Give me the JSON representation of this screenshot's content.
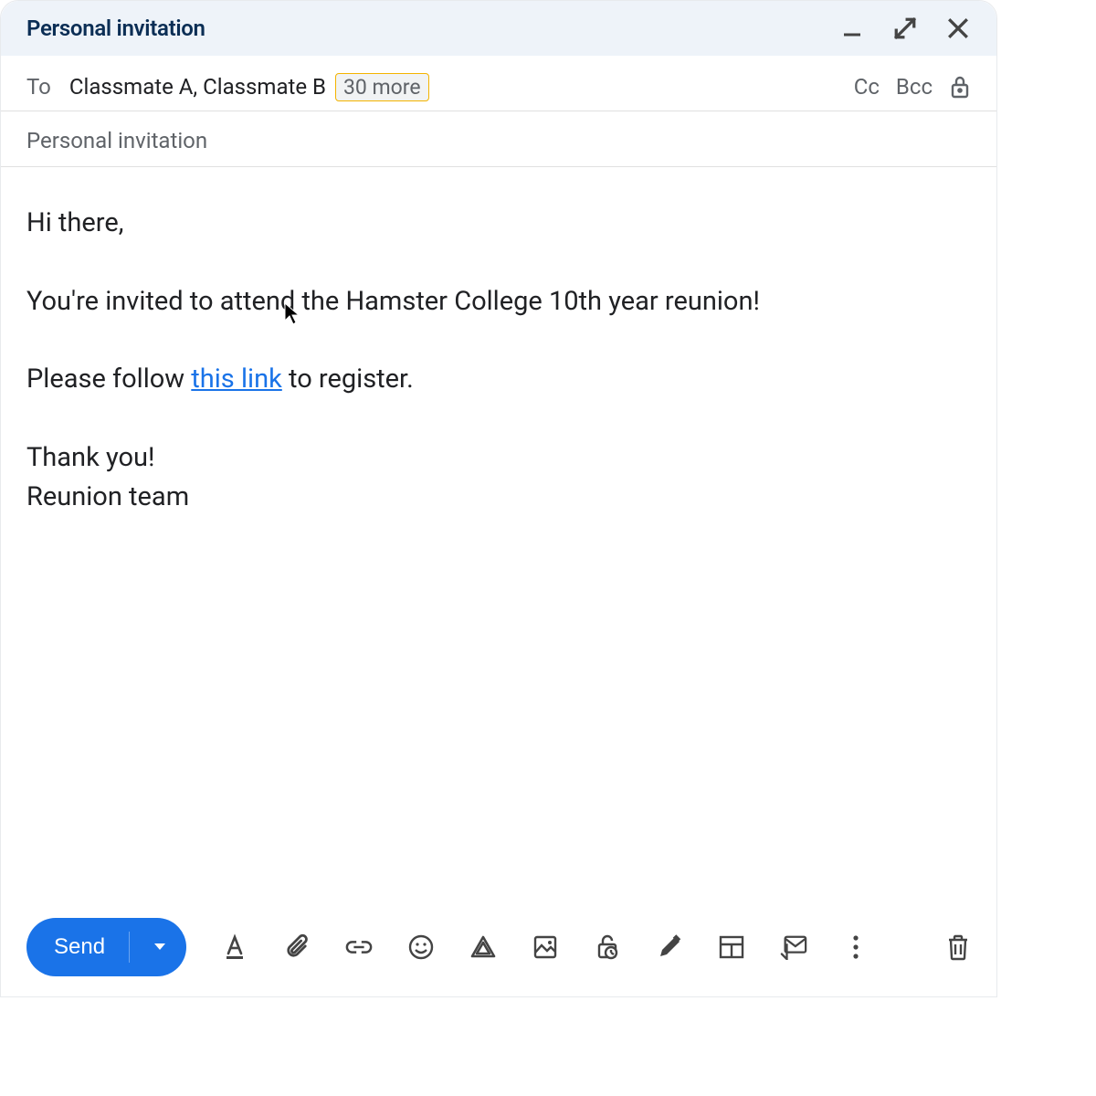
{
  "header": {
    "title": "Personal invitation"
  },
  "recipients": {
    "to_label": "To",
    "names": "Classmate A, Classmate B",
    "more_count": "30 more",
    "cc_label": "Cc",
    "bcc_label": "Bcc"
  },
  "subject": "Personal invitation",
  "body": {
    "greeting": "Hi there,",
    "line1": "You're invited to attend the Hamster College 10th year reunion!",
    "line2_pre": "Please follow ",
    "link_text": "this link",
    "line2_post": " to register.",
    "thanks": "Thank you!",
    "signature": "Reunion team"
  },
  "toolbar": {
    "send_label": "Send"
  }
}
